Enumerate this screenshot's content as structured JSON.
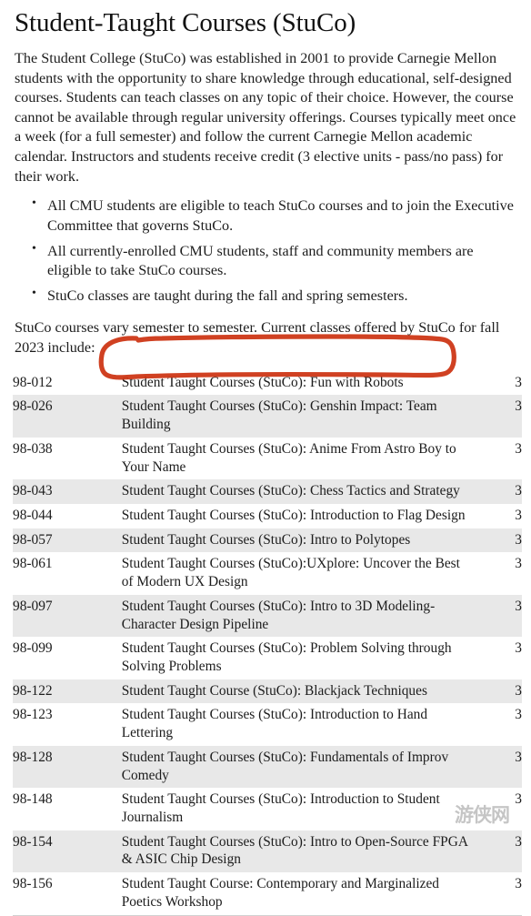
{
  "document": {
    "title": "Student-Taught Courses (StuCo)",
    "intro_paragraph": "The Student College (StuCo) was established in 2001 to provide Carnegie Mellon students with the opportunity to share knowledge through educational, self-designed courses. Students can teach classes on any topic of their choice. However, the course cannot be available through regular university offerings. Courses typically meet once a week (for a full semester) and follow the current Carnegie Mellon academic calendar. Instructors and students receive credit (3 elective units - pass/no pass) for their work.",
    "bullets": [
      "All CMU students are eligible to teach StuCo courses and to join the Executive Committee that governs StuCo.",
      "All currently-enrolled CMU students, staff and community members are eligible to take StuCo courses.",
      "StuCo classes are taught during the fall and spring semesters."
    ],
    "closing_paragraph": "StuCo courses vary semester to semester. Current classes offered by StuCo for fall 2023 include:"
  },
  "course_table": {
    "rows": [
      {
        "number": "98-012",
        "title": "Student Taught Courses (StuCo): Fun with Robots",
        "units": "3",
        "shaded": false,
        "highlighted": false
      },
      {
        "number": "98-026",
        "title": "Student Taught Courses (StuCo): Genshin Impact: Team Building",
        "units": "3",
        "shaded": true,
        "highlighted": true
      },
      {
        "number": "98-038",
        "title": "Student Taught Courses (StuCo): Anime From Astro Boy to Your Name",
        "units": "3",
        "shaded": false,
        "highlighted": false
      },
      {
        "number": "98-043",
        "title": "Student Taught Courses (StuCo): Chess Tactics and Strategy",
        "units": "3",
        "shaded": true,
        "highlighted": false
      },
      {
        "number": "98-044",
        "title": "Student Taught Courses (StuCo): Introduction to Flag Design",
        "units": "3",
        "shaded": false,
        "highlighted": false
      },
      {
        "number": "98-057",
        "title": "Student Taught Courses (StuCo): Intro to Polytopes",
        "units": "3",
        "shaded": true,
        "highlighted": false
      },
      {
        "number": "98-061",
        "title": "Student Taught Courses (StuCo):UXplore: Uncover the Best of Modern UX Design",
        "units": "3",
        "shaded": false,
        "highlighted": false
      },
      {
        "number": "98-097",
        "title": "Student Taught Courses (StuCo): Intro to 3D Modeling- Character Design Pipeline",
        "units": "3",
        "shaded": true,
        "highlighted": false
      },
      {
        "number": "98-099",
        "title": "Student Taught Courses (StuCo): Problem Solving through Solving Problems",
        "units": "3",
        "shaded": false,
        "highlighted": false
      },
      {
        "number": "98-122",
        "title": "Student Taught Course (StuCo): Blackjack Techniques",
        "units": "3",
        "shaded": true,
        "highlighted": false
      },
      {
        "number": "98-123",
        "title": "Student Taught Courses (StuCo): Introduction to Hand Lettering",
        "units": "3",
        "shaded": false,
        "highlighted": false
      },
      {
        "number": "98-128",
        "title": "Student Taught Courses (StuCo): Fundamentals of Improv Comedy",
        "units": "3",
        "shaded": true,
        "highlighted": false
      },
      {
        "number": "98-148",
        "title": "Student Taught Courses (StuCo): Introduction to Student Journalism",
        "units": "3",
        "shaded": false,
        "highlighted": false
      },
      {
        "number": "98-154",
        "title": "Student Taught Courses (StuCo): Intro to Open-Source FPGA & ASIC Chip Design",
        "units": "3",
        "shaded": true,
        "highlighted": false
      },
      {
        "number": "98-156",
        "title": "Student Taught Course: Contemporary and Marginalized Poetics Workshop",
        "units": "3",
        "shaded": false,
        "highlighted": false
      }
    ]
  },
  "annotation": {
    "type": "hand-drawn-ellipse",
    "color": "#cc3311",
    "target_course_number": "98-026",
    "target_course_title": "Student Taught Courses (StuCo): Genshin Impact: Team Building"
  },
  "watermark": {
    "text": "游侠网"
  },
  "colors": {
    "page_background": "#ffffff",
    "row_shaded": "#e8e8e8",
    "text": "#1c1c1c",
    "annotation_red": "#cc3311"
  }
}
